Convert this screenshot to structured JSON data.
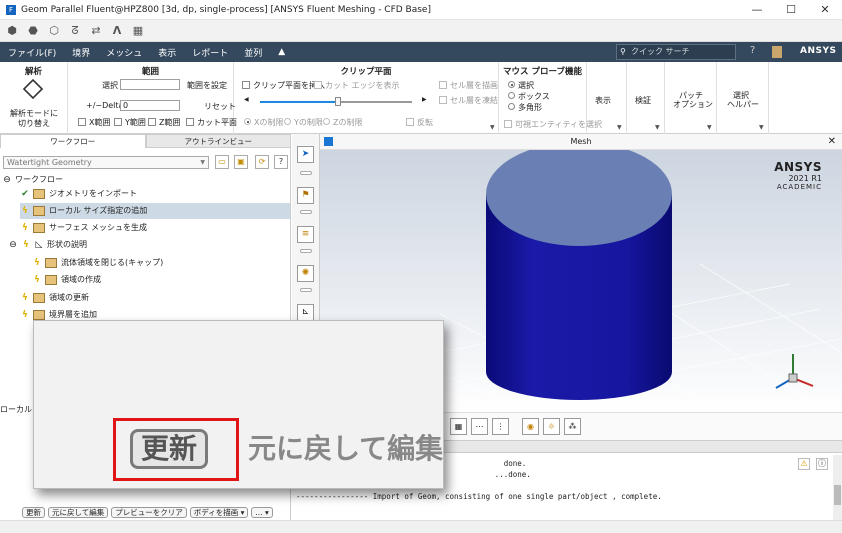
{
  "window": {
    "title": "Geom Parallel Fluent@HPZ800  [3d, dp, single-process] [ANSYS Fluent Meshing - CFD Base]",
    "controls": [
      "—",
      "☐",
      "✕"
    ]
  },
  "quickbar": {
    "icons": [
      "⬢",
      "⬣",
      "⬡",
      "ᘔ",
      "⇄",
      "𝝠",
      "▦"
    ]
  },
  "menubar": {
    "items": [
      "ファイル(F)",
      "境界",
      "メッシュ",
      "表示",
      "レポート",
      "並列",
      "▲"
    ],
    "search_placeholder": "クイック サーチ",
    "brand": "ANSYS"
  },
  "ribbon": {
    "analysis": {
      "title": "解析",
      "button_label_1": "解析モードに",
      "button_label_2": "切り替え"
    },
    "range": {
      "title": "範囲",
      "select_label": "選択",
      "set_range": "範囲を設定",
      "delta_label": "+/−Delta",
      "delta_value": "0",
      "reset": "リセット",
      "x_range": "X範囲",
      "y_range": "Y範囲",
      "z_range": "Z範囲",
      "cut_plane": "カット平面"
    },
    "clip": {
      "title": "クリップ平面",
      "insert": "クリップ平面を挿入",
      "show_edges": "カット エッジを表示",
      "x_limit": "Xの制限",
      "y_limit": "Yの制限",
      "z_limit": "Zの制限",
      "invert": "反転",
      "draw_cell": "セル層を描画",
      "freeze_cell": "セル層を凍結"
    },
    "probe": {
      "title": "マウス プローブ機能",
      "select": "選択",
      "box": "ボックス",
      "polygon": "多角形",
      "select_visible": "可視エンティティを選択"
    },
    "display": "表示",
    "verify": "検証",
    "patch_1": "パッチ",
    "patch_2": "オプション",
    "select_helper_1": "選択",
    "select_helper_2": "ヘルパー"
  },
  "leftpanel": {
    "tabs": [
      "ワークフロー",
      "アウトラインビュー"
    ],
    "workflow_select": "Watertight Geometry",
    "tree_root": "ワークフロー",
    "items": [
      "ジオメトリをインポート",
      "ローカル サイズ指定の追加",
      "サーフェス メッシュを生成",
      "形状の説明",
      "流体領域を閉じる(キャップ)",
      "領域の作成",
      "領域の更新",
      "境界層を追加"
    ],
    "side_label": "ローカル サ",
    "bottom_buttons": [
      "更新",
      "元に戻して編集",
      "プレビューをクリア",
      "ボディを描画 ▾",
      "... ▾"
    ]
  },
  "popup": {
    "big_button": "更新",
    "big_text": "元に戻して編集"
  },
  "graphics": {
    "title": "Mesh",
    "watermark": {
      "brand": "ANSYS",
      "release": "2021 R1",
      "edition": "ACADEMIC"
    },
    "cylinder_color": "#1a1aa0",
    "cylinder_top_color": "#6a80b4"
  },
  "console": {
    "lines": [
      "                                              done.",
      "                                            ...done.",
      "",
      "---------------- Import of Geom, consisting of one single part/object , complete."
    ]
  }
}
